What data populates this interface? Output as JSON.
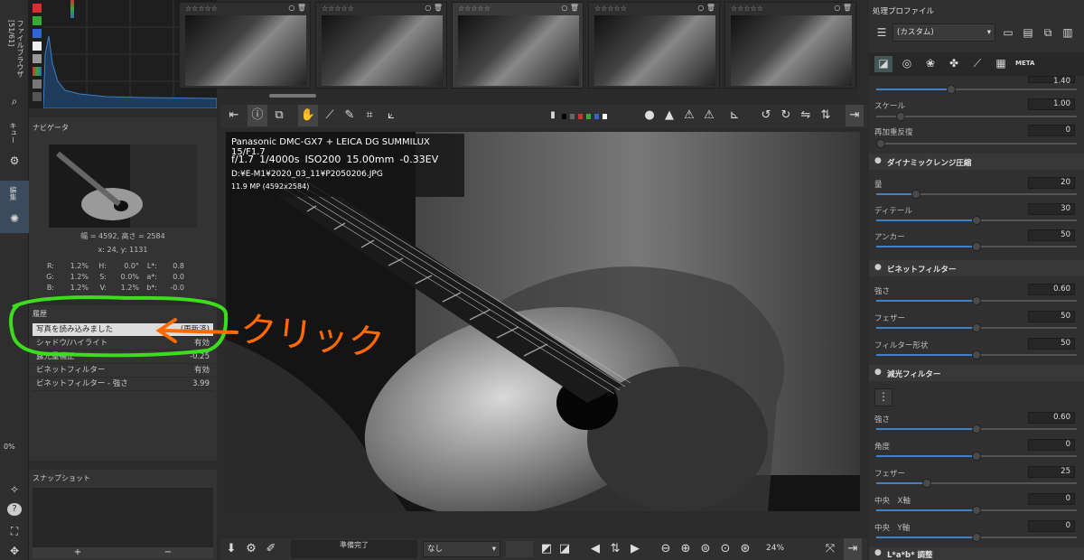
{
  "left_strip": {
    "tab_file_browser": "ファイルブラウザ [51/61]",
    "tab_queue": "キュー",
    "tab_edit": "編集",
    "zoom_label": "0%"
  },
  "navigator": {
    "title": "ナビゲータ",
    "size": "幅 = 4592, 高さ = 2584",
    "coords": "x: 24, y: 1131",
    "rows": [
      [
        "R:",
        "1.2%",
        "H:",
        "0.0°",
        "L*:",
        "0.8"
      ],
      [
        "G:",
        "1.2%",
        "S:",
        "0.0%",
        "a*:",
        "0.0"
      ],
      [
        "B:",
        "1.2%",
        "V:",
        "1.2%",
        "b*:",
        "-0.0"
      ]
    ]
  },
  "history": {
    "title": "履歴",
    "items": [
      {
        "label": "写真を読み込みました",
        "value": "(更新済)"
      },
      {
        "label": "シャドウ/ハイライト",
        "value": "有効"
      },
      {
        "label": "露光量補正",
        "value": "-0.25"
      },
      {
        "label": "ビネットフィルター",
        "value": "有効"
      },
      {
        "label": "ビネットフィルター - 強さ",
        "value": "3.99"
      }
    ]
  },
  "snapshot": {
    "title": "スナップショット",
    "add": "+",
    "remove": "−"
  },
  "annotation": {
    "text": "クリック",
    "color": "#ff6a00",
    "outline": "#3ddc1d"
  },
  "filmstrip": {
    "stars": "☆☆☆☆☆"
  },
  "info_overlay": {
    "camera": "Panasonic DMC-GX7 + LEICA DG SUMMILUX 15/F1.7",
    "aperture": "f/1.7",
    "shutter": "1/4000s",
    "iso": "ISO200",
    "focal": "15.00mm",
    "ev": "-0.33EV",
    "path": "D:¥E-M1¥2020_03_11¥P2050206.JPG",
    "mp": "11.9 MP (4592x2584)"
  },
  "bottom": {
    "status": "準備完了",
    "dropdown": "なし",
    "zoom": "24%"
  },
  "right": {
    "profile_title": "処理プロファイル",
    "profile_value": "(カスタム)",
    "meta": "META",
    "top_partial_value": "1.40",
    "scale_label": "スケール",
    "scale_value": "1.00",
    "reweight_label": "再加重反復",
    "reweight_value": "0",
    "drc_title": "ダイナミックレンジ圧縮",
    "drc": [
      {
        "label": "量",
        "value": "20",
        "frac": 0.2
      },
      {
        "label": "ディテール",
        "value": "30",
        "frac": 0.5
      },
      {
        "label": "アンカー",
        "value": "50",
        "frac": 0.5
      }
    ],
    "vig_title": "ビネットフィルター",
    "vig": [
      {
        "label": "強さ",
        "value": "0.60",
        "frac": 0.5
      },
      {
        "label": "フェザー",
        "value": "50",
        "frac": 0.5
      },
      {
        "label": "フィルター形状",
        "value": "50",
        "frac": 0.5
      }
    ],
    "grad_title": "減光フィルター",
    "grad": [
      {
        "label": "強さ",
        "value": "0.60",
        "frac": 0.5
      },
      {
        "label": "角度",
        "value": "0",
        "frac": 0.5
      },
      {
        "label": "フェザー",
        "value": "25",
        "frac": 0.25
      },
      {
        "label": "中央　X軸",
        "value": "0",
        "frac": 0.5
      },
      {
        "label": "中央　Y軸",
        "value": "0",
        "frac": 0.5
      }
    ],
    "lab_title": "L*a*b* 調整"
  }
}
